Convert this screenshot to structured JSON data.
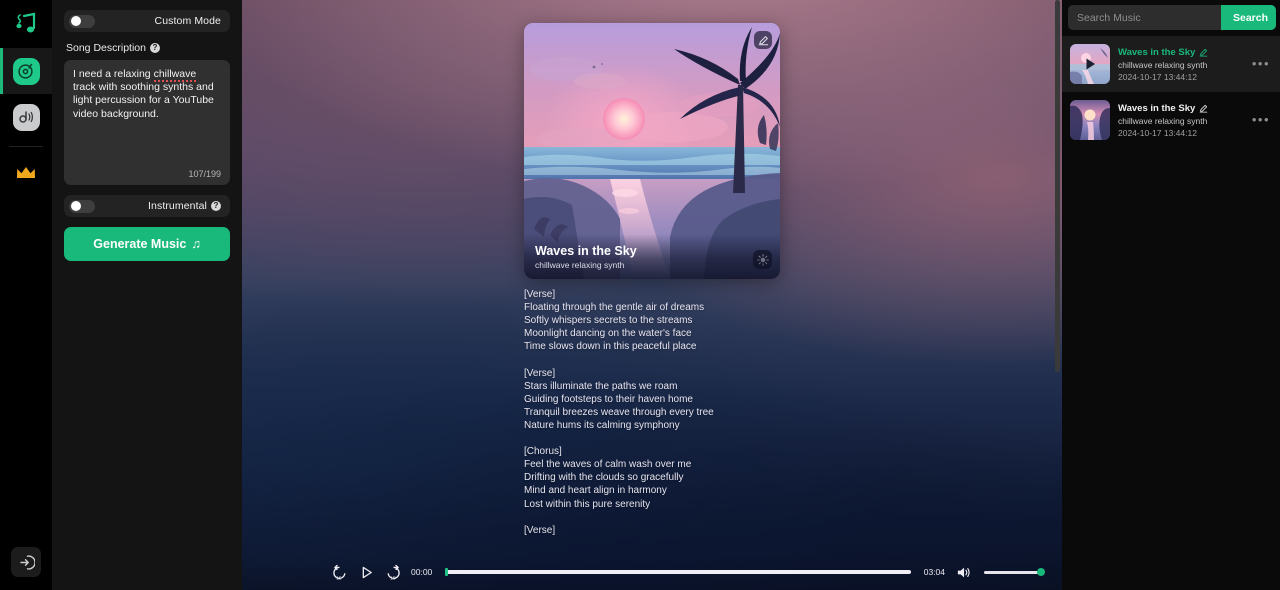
{
  "rail": {
    "logo_icon": "music-note-logo",
    "items": [
      {
        "icon": "vinyl-disc-icon",
        "active": true,
        "name": "create-music"
      },
      {
        "icon": "audio-wave-icon",
        "active": false,
        "name": "audio-tools"
      }
    ],
    "crown_icon": "crown-icon",
    "bottom_icon": "sign-in-icon"
  },
  "panel": {
    "custom_mode": {
      "label": "Custom Mode",
      "enabled": false,
      "help": "?"
    },
    "song_description": {
      "label": "Song Description",
      "help": "?",
      "value": "I need a relaxing chillwave track with soothing synths and light percussion for a YouTube video background.",
      "misspelled_word": "chillwave",
      "char_count": "107/199"
    },
    "instrumental": {
      "label": "Instrumental",
      "enabled": false,
      "help": "?"
    },
    "generate_button": {
      "label": "Generate Music",
      "icon": "music-note-icon",
      "glyph": "♫"
    }
  },
  "stage": {
    "artwork": {
      "title": "Waves in the Sky",
      "subtitle": "chillwave relaxing synth",
      "edit_icon": "edit-pencil-icon",
      "effects_icon": "brightness-sparkle-icon",
      "description": "sunset beach scene with palm tree and pink sky reflected on water"
    },
    "lyrics": "[Verse]\nFloating through the gentle air of dreams\nSoftly whispers secrets to the streams\nMoonlight dancing on the water's face\nTime slows down in this peaceful place\n\n[Verse]\nStars illuminate the paths we roam\nGuiding footsteps to their haven home\nTranquil breezes weave through every tree\nNature hums its calming symphony\n\n[Chorus]\nFeel the waves of calm wash over me\nDrifting with the clouds so gracefully\nMind and heart align in harmony\nLost within this pure serenity\n\n[Verse]"
  },
  "player": {
    "rewind_icon": "rewind-15-icon",
    "play_icon": "play-icon",
    "forward_icon": "forward-15-icon",
    "current_time": "00:00",
    "duration": "03:04",
    "progress_percent": 0,
    "volume_icon": "volume-icon",
    "volume_percent": 100,
    "accent_color": "#19b87b"
  },
  "library": {
    "search": {
      "placeholder": "Search Music",
      "value": "",
      "button_label": "Search"
    },
    "tracks": [
      {
        "title": "Waves in the Sky",
        "subtitle": "chillwave relaxing synth",
        "date": "2024-10-17 13:44:12",
        "playing": true,
        "selected": true,
        "edit_icon": "edit-pencil-icon",
        "play_overlay_icon": "play-icon",
        "menu_icon": "more-options-icon",
        "menu_glyph": "•••"
      },
      {
        "title": "Waves in the Sky",
        "subtitle": "chillwave relaxing synth",
        "date": "2024-10-17 13:44:12",
        "playing": false,
        "selected": false,
        "edit_icon": "edit-pencil-icon",
        "menu_icon": "more-options-icon",
        "menu_glyph": "•••"
      }
    ]
  }
}
